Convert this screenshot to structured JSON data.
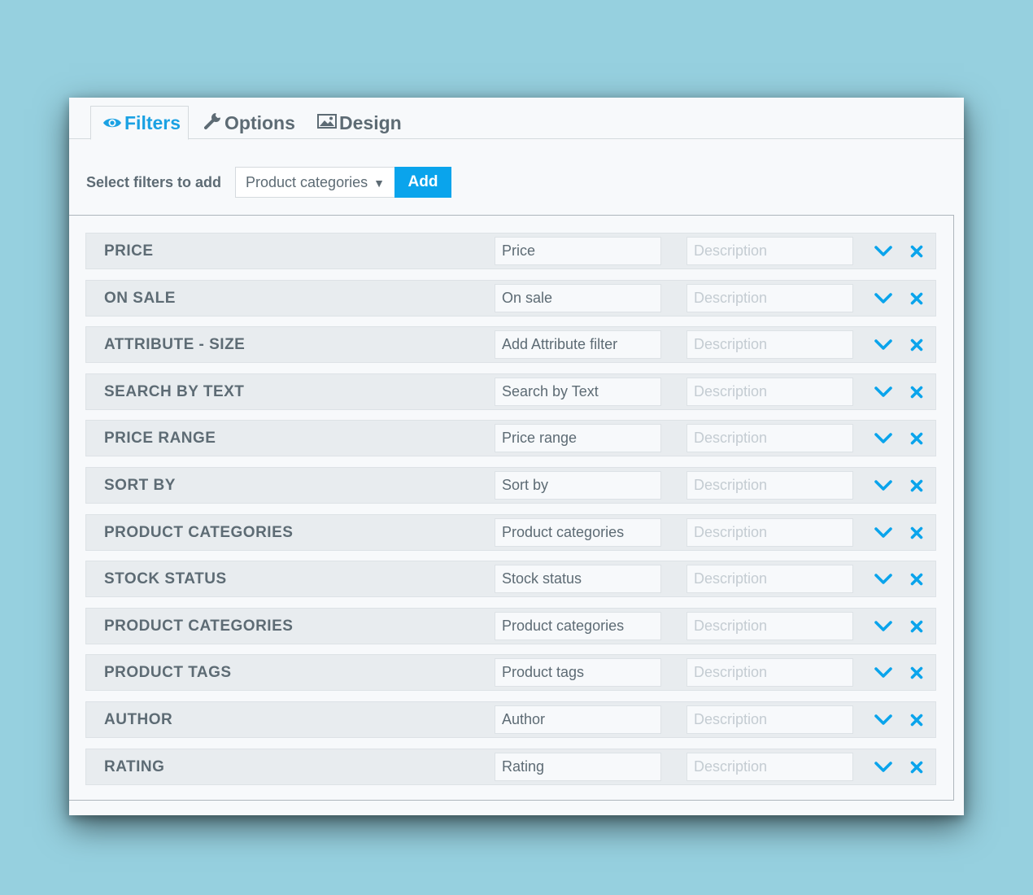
{
  "tabs": [
    {
      "label": "Filters",
      "icon": "eye-icon",
      "active": true
    },
    {
      "label": "Options",
      "icon": "wrench-icon",
      "active": false
    },
    {
      "label": "Design",
      "icon": "image-icon",
      "active": false
    }
  ],
  "toolbar": {
    "label": "Select filters to add",
    "selected": "Product categories",
    "add_label": "Add"
  },
  "colors": {
    "accent": "#0aa4ec",
    "text": "#5d6b74",
    "row_bg": "#e8ecef"
  },
  "filters": [
    {
      "title": "PRICE",
      "label": "Price",
      "description_placeholder": "Description"
    },
    {
      "title": "ON SALE",
      "label": "On sale",
      "description_placeholder": "Description"
    },
    {
      "title": "ATTRIBUTE - SIZE",
      "label": "Add Attribute filter",
      "description_placeholder": "Description"
    },
    {
      "title": "SEARCH BY TEXT",
      "label": "Search by Text",
      "description_placeholder": "Description"
    },
    {
      "title": "PRICE RANGE",
      "label": "Price range",
      "description_placeholder": "Description"
    },
    {
      "title": "SORT BY",
      "label": "Sort by",
      "description_placeholder": "Description"
    },
    {
      "title": "PRODUCT CATEGORIES",
      "label": "Product categories",
      "description_placeholder": "Description"
    },
    {
      "title": "STOCK STATUS",
      "label": "Stock status",
      "description_placeholder": "Description"
    },
    {
      "title": "PRODUCT CATEGORIES",
      "label": "Product categories",
      "description_placeholder": "Description"
    },
    {
      "title": "PRODUCT TAGS",
      "label": "Product tags",
      "description_placeholder": "Description"
    },
    {
      "title": "AUTHOR",
      "label": "Author",
      "description_placeholder": "Description"
    },
    {
      "title": "RATING",
      "label": "Rating",
      "description_placeholder": "Description"
    }
  ]
}
